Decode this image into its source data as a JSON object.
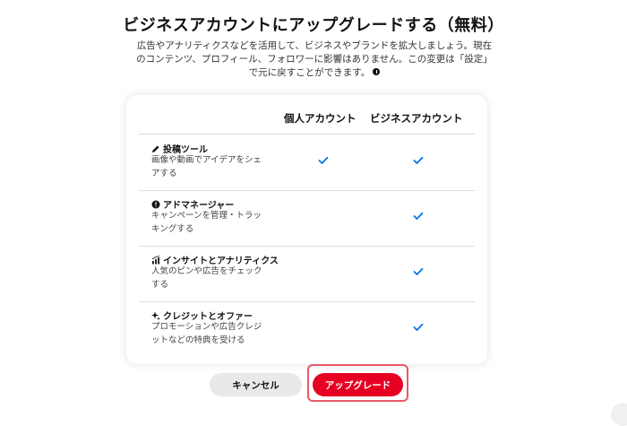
{
  "dialog": {
    "title": "ビジネスアカウントにアップグレードする（無料）",
    "description": "広告やアナリティクスなどを活用して、ビジネスやブランドを拡大しましょう。現在のコンテンツ、プロフィール、フォロワーに影響はありません。この変更は「設定」で元に戻すことができます。"
  },
  "table": {
    "headers": {
      "personal": "個人アカウント",
      "business": "ビジネスアカウント"
    },
    "rows": [
      {
        "icon": "pencil-icon",
        "title": "投稿ツール",
        "desc": "画像や動画でアイデアをシェアする",
        "personal": true,
        "business": true
      },
      {
        "icon": "alert-icon",
        "title": "アドマネージャー",
        "desc": "キャンペーンを管理・トラッキングする",
        "personal": false,
        "business": true
      },
      {
        "icon": "analytics-icon",
        "title": "インサイトとアナリティクス",
        "desc": "人気のピンや広告をチェックする",
        "personal": false,
        "business": true
      },
      {
        "icon": "sparkle-icon",
        "title": "クレジットとオファー",
        "desc": "プロモーションや広告クレジットなどの特典を受ける",
        "personal": false,
        "business": true
      }
    ]
  },
  "buttons": {
    "cancel": "キャンセル",
    "upgrade": "アップグレード"
  },
  "colors": {
    "accent": "#e60023",
    "check": "#0074e8",
    "highlight": "#e8596a"
  }
}
